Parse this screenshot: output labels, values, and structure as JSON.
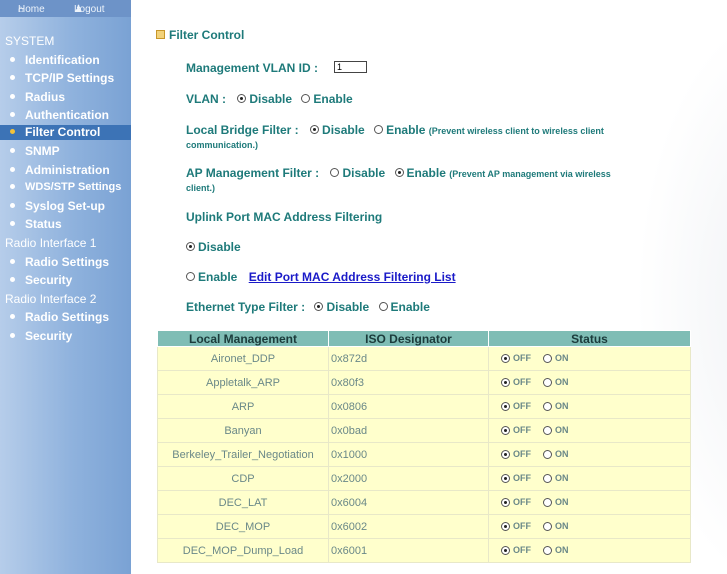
{
  "topnav": {
    "home": "Home",
    "logout": "Logout"
  },
  "sidebar": {
    "system": "SYSTEM",
    "system_items": [
      {
        "label": "Identification"
      },
      {
        "label": "TCP/IP Settings"
      },
      {
        "label": "Radius"
      },
      {
        "label": "Authentication"
      },
      {
        "label": "Filter Control",
        "active": true
      },
      {
        "label": "SNMP"
      },
      {
        "label": "Administration"
      },
      {
        "label": "WDS/STP Settings"
      },
      {
        "label": "Syslog Set-up"
      },
      {
        "label": "Status"
      }
    ],
    "radio1": "Radio Interface 1",
    "radio1_items": [
      {
        "label": "Radio Settings"
      },
      {
        "label": "Security"
      }
    ],
    "radio2": "Radio Interface 2",
    "radio2_items": [
      {
        "label": "Radio Settings"
      },
      {
        "label": "Security"
      }
    ]
  },
  "page": {
    "title": "Filter Control",
    "mgmt_vlan_label": "Management VLAN ID :",
    "mgmt_vlan_value": "1",
    "vlan_label": "VLAN :",
    "disable": "Disable",
    "enable": "Enable",
    "local_bridge_label": "Local Bridge Filter :",
    "local_bridge_note_1": "(Prevent wireless client to wireless client",
    "local_bridge_note_2": "communication.)",
    "ap_mgmt_label": "AP Management Filter :",
    "ap_mgmt_note_1": "(Prevent AP management via wireless",
    "ap_mgmt_note_2": "client.)",
    "uplink_label": "Uplink Port MAC Address Filtering",
    "edit_link": "Edit Port MAC Address Filtering List",
    "ethernet_label": "Ethernet Type Filter :"
  },
  "table": {
    "headers": [
      "Local Management",
      "ISO Designator",
      "Status"
    ],
    "off": "OFF",
    "on": "ON",
    "rows": [
      {
        "name": "Aironet_DDP",
        "iso": "0x872d"
      },
      {
        "name": "Appletalk_ARP",
        "iso": "0x80f3"
      },
      {
        "name": "ARP",
        "iso": "0x0806"
      },
      {
        "name": "Banyan",
        "iso": "0x0bad"
      },
      {
        "name": "Berkeley_Trailer_Negotiation",
        "iso": "0x1000"
      },
      {
        "name": "CDP",
        "iso": "0x2000"
      },
      {
        "name": "DEC_LAT",
        "iso": "0x6004"
      },
      {
        "name": "DEC_MOP",
        "iso": "0x6002"
      },
      {
        "name": "DEC_MOP_Dump_Load",
        "iso": "0x6001"
      }
    ]
  }
}
